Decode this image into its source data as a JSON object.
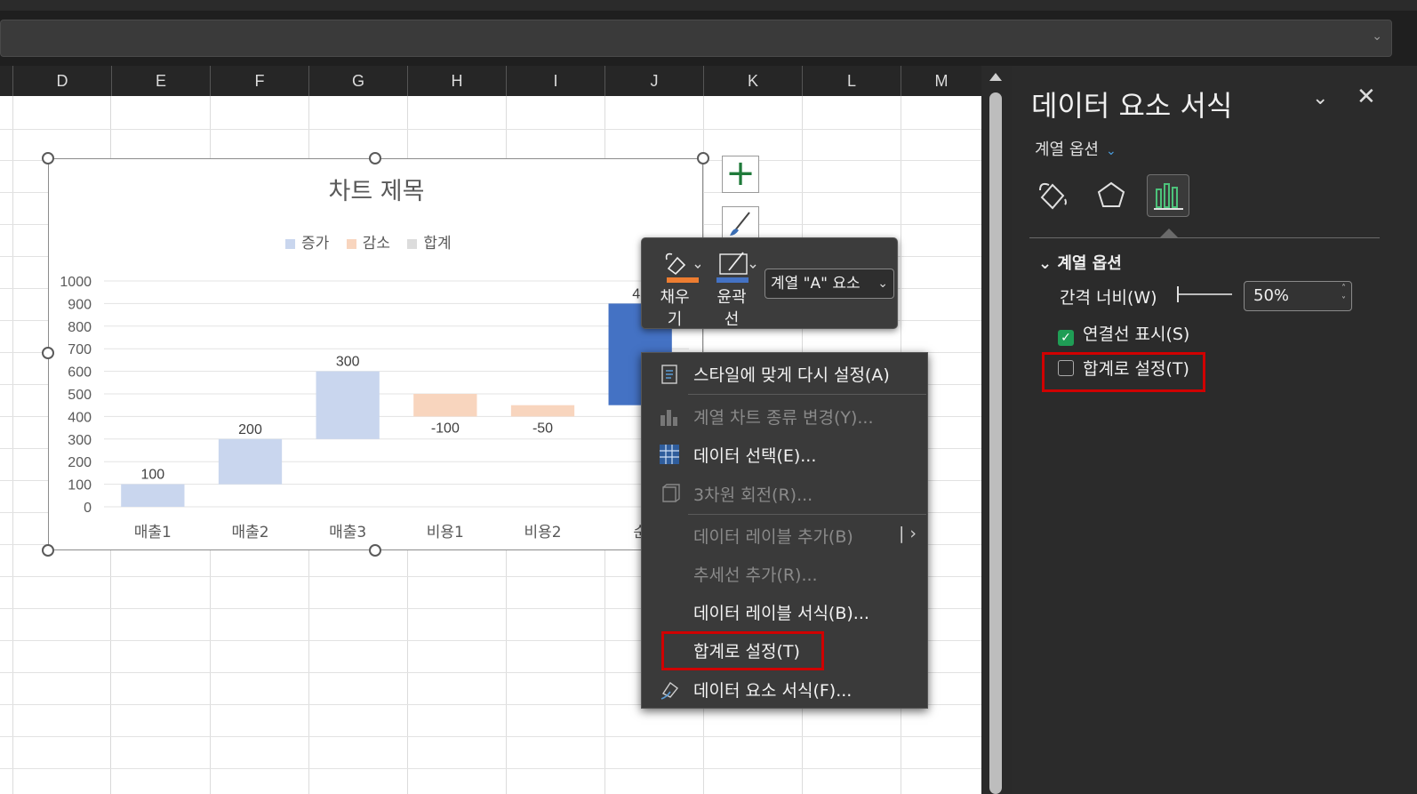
{
  "columns": [
    "D",
    "E",
    "F",
    "G",
    "H",
    "I",
    "J",
    "K",
    "L",
    "M"
  ],
  "chart": {
    "title": "차트 제목",
    "legend": [
      {
        "label": "증가",
        "color": "#c9d6ee"
      },
      {
        "label": "감소",
        "color": "#f8d5be"
      },
      {
        "label": "합계",
        "color": "#dcdcdc"
      }
    ],
    "visible_total_label": "45"
  },
  "chart_data": {
    "type": "bar",
    "subtype": "waterfall",
    "categories": [
      "매출1",
      "매출2",
      "매출3",
      "비용1",
      "비용2",
      "순이"
    ],
    "category_display": [
      "매출1",
      "매출2",
      "매출3",
      "비용1",
      "비용2",
      "순"
    ],
    "values": [
      100,
      200,
      300,
      -100,
      -50,
      450
    ],
    "base": [
      0,
      100,
      300,
      500,
      450,
      450
    ],
    "labels": [
      "100",
      "200",
      "300",
      "-100",
      "-50",
      "45"
    ],
    "colors": [
      "#c9d6ee",
      "#c9d6ee",
      "#c9d6ee",
      "#f8d5be",
      "#f8d5be",
      "#4472c4"
    ],
    "ylim": [
      0,
      1000
    ],
    "yticks": [
      0,
      100,
      200,
      300,
      400,
      500,
      600,
      700,
      800,
      900,
      1000
    ],
    "grid": true,
    "legend_position": "top"
  },
  "mini_toolbar": {
    "fill_label": "채우\n기",
    "outline_label": "윤곽\n선",
    "series_select": "계열 \"A\" 요소"
  },
  "context_menu": {
    "items": [
      {
        "label": "스타일에 맞게 다시 설정(A)",
        "icon": "reset-style-icon",
        "disabled": false
      },
      {
        "label": "계열 차트 종류 변경(Y)...",
        "icon": "chart-type-icon",
        "disabled": true
      },
      {
        "label": "데이터 선택(E)...",
        "icon": "select-data-icon",
        "disabled": false
      },
      {
        "label": "3차원 회전(R)...",
        "icon": "rotate-3d-icon",
        "disabled": true
      },
      {
        "label": "데이터 레이블 추가(B)",
        "icon": "",
        "disabled": true
      },
      {
        "label": "추세선 추가(R)...",
        "icon": "",
        "disabled": true
      },
      {
        "label": "데이터 레이블 서식(B)...",
        "icon": "",
        "disabled": false
      },
      {
        "label": "합계로 설정(T)",
        "icon": "",
        "disabled": false
      },
      {
        "label": "데이터 요소 서식(F)...",
        "icon": "format-point-icon",
        "disabled": false
      }
    ]
  },
  "pane": {
    "title": "데이터 요소 서식",
    "subtitle": "계열 옵션",
    "section_title": "계열 옵션",
    "gap_label": "간격 너비(W)",
    "gap_value": "50%",
    "connector_label": "연결선 표시(S)",
    "connector_checked": true,
    "total_label": "합계로 설정(T)",
    "total_checked": false
  }
}
